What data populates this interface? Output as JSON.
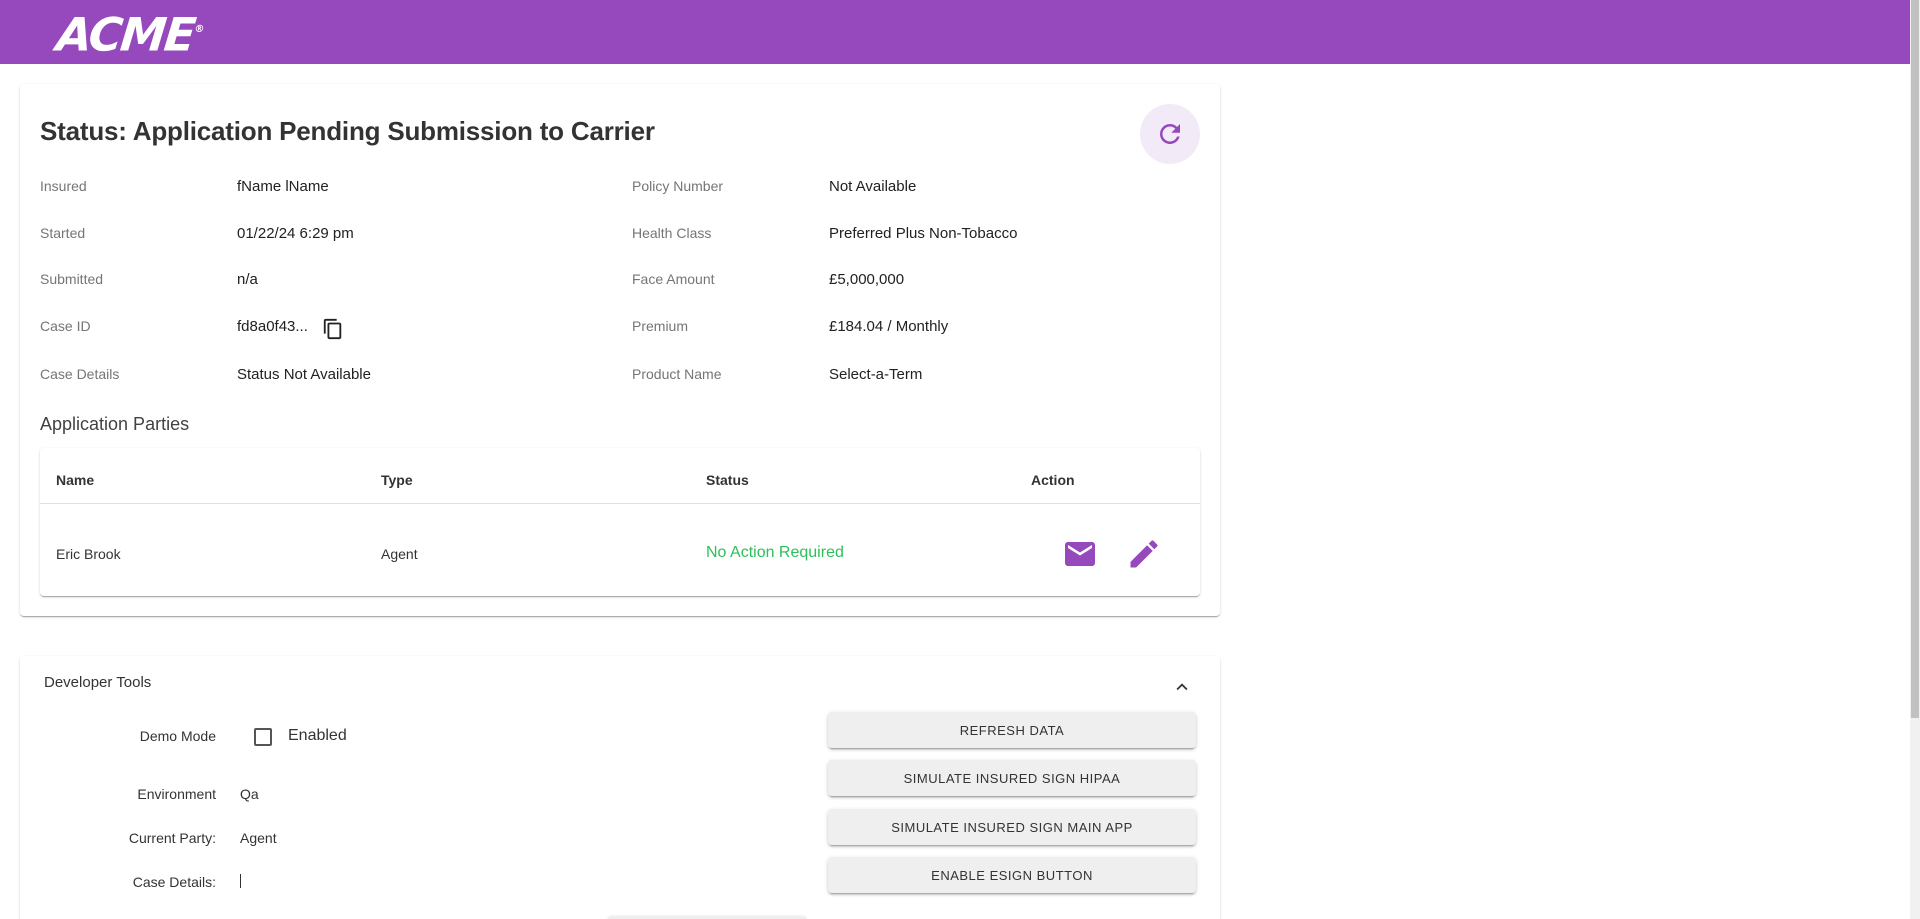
{
  "header": {
    "logo_text": "ACME",
    "logo_mark": "®",
    "brand_color": "#9649bd"
  },
  "status_card": {
    "title": "Status: Application Pending Submission to Carrier",
    "refresh_icon": "refresh-icon",
    "left_fields": [
      {
        "label": "Insured",
        "value": "fName lName"
      },
      {
        "label": "Started",
        "value": "01/22/24 6:29 pm"
      },
      {
        "label": "Submitted",
        "value": "n/a"
      },
      {
        "label": "Case ID",
        "value": "fd8a0f43..."
      },
      {
        "label": "Case Details",
        "value": "Status Not Available"
      }
    ],
    "right_fields": [
      {
        "label": "Policy Number",
        "value": "Not Available"
      },
      {
        "label": "Health Class",
        "value": "Preferred Plus Non-Tobacco"
      },
      {
        "label": "Face Amount",
        "value": "£5,000,000"
      },
      {
        "label": "Premium",
        "value": "£184.04 / Monthly"
      },
      {
        "label": "Product Name",
        "value": "Select-a-Term"
      }
    ],
    "copy_icon": "copy-icon"
  },
  "parties": {
    "title": "Application Parties",
    "columns": [
      "Name",
      "Type",
      "Status",
      "Action"
    ],
    "rows": [
      {
        "name": "Eric Brook",
        "type": "Agent",
        "status": "No Action Required",
        "status_color": "#2ebf5b",
        "actions": [
          "mail-icon",
          "edit-icon"
        ]
      }
    ]
  },
  "dev_tools": {
    "title": "Developer Tools",
    "demo_mode_label": "Demo Mode",
    "demo_mode_checkbox_label": "Enabled",
    "demo_mode_checked": false,
    "environment_label": "Environment",
    "environment_value": "Qa",
    "current_party_label": "Current Party:",
    "current_party_value": "Agent",
    "case_details_label": "Case Details:",
    "case_details_value": "",
    "buttons": [
      "REFRESH DATA",
      "SIMULATE INSURED SIGN HIPAA",
      "SIMULATE INSURED SIGN MAIN APP",
      "ENABLE ESIGN BUTTON"
    ]
  }
}
